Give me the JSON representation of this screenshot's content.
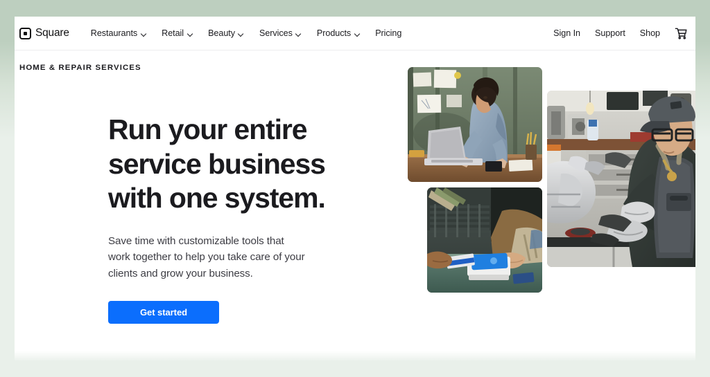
{
  "theme": {
    "backdrop_green": "#bdcfbf",
    "backdrop_green_light": "#e9f0ea",
    "card_background": "#ffffff",
    "text_primary": "#1b1b1f",
    "text_secondary": "#3d3d44",
    "cta_blue": "#0b6efd",
    "divider": "#ecedee"
  },
  "nav": {
    "brand": {
      "name": "Square",
      "logo_icon": "square-logo-icon"
    },
    "links": [
      {
        "label": "Restaurants",
        "has_dropdown": true,
        "icon": "chevron-down-icon"
      },
      {
        "label": "Retail",
        "has_dropdown": true,
        "icon": "chevron-down-icon"
      },
      {
        "label": "Beauty",
        "has_dropdown": true,
        "icon": "chevron-down-icon"
      },
      {
        "label": "Services",
        "has_dropdown": true,
        "icon": "chevron-down-icon"
      },
      {
        "label": "Products",
        "has_dropdown": true,
        "icon": "chevron-down-icon"
      },
      {
        "label": "Pricing",
        "has_dropdown": false,
        "icon": ""
      }
    ],
    "utilities": [
      {
        "label": "Sign In"
      },
      {
        "label": "Support"
      },
      {
        "label": "Shop"
      }
    ],
    "cart": {
      "icon": "shopping-cart-icon",
      "label": "Cart"
    }
  },
  "breadcrumb": {
    "label": "HOME & REPAIR SERVICES"
  },
  "hero": {
    "title": "Run your entire service business with one system.",
    "subtitle": "Save time with customizable tools that work together to help you take care of your clients and grow your business.",
    "cta": {
      "label": "Get started"
    },
    "media": [
      {
        "name": "photo-laptop",
        "alt": "Service business owner working on a laptop at a wooden desk against a green wall"
      },
      {
        "name": "photo-payment",
        "alt": "Customer tapping a credit card on a Square payment terminal held by a worker"
      },
      {
        "name": "photo-workshop",
        "alt": "Mechanic wearing a cap, glasses and apron repairing a machine part in a workshop"
      }
    ]
  }
}
